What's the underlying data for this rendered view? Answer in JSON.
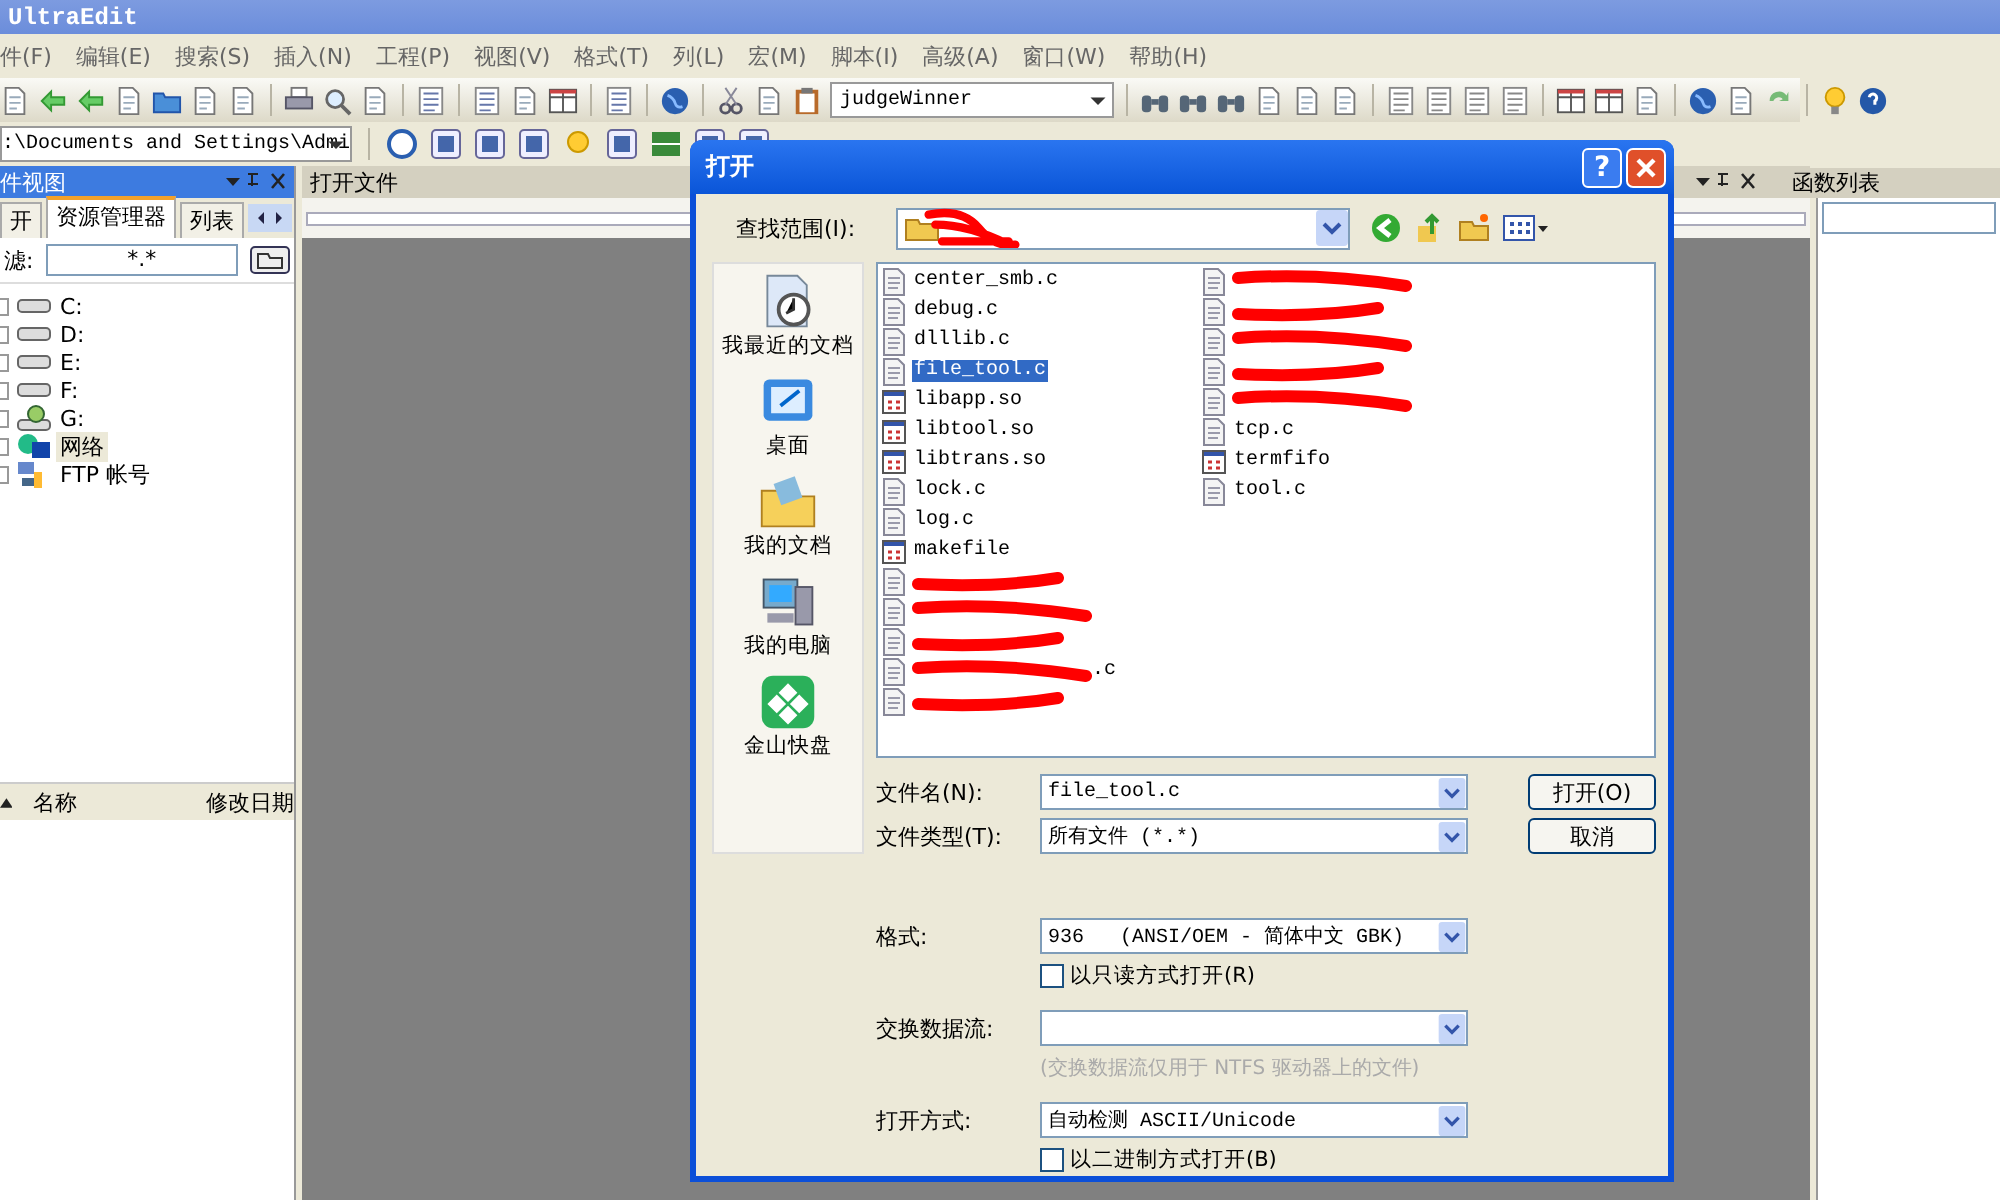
{
  "window": {
    "title": "UltraEdit"
  },
  "menu": [
    "件(F)",
    "编辑(E)",
    "搜索(S)",
    "插入(N)",
    "工程(P)",
    "视图(V)",
    "格式(T)",
    "列(L)",
    "宏(M)",
    "脚本(I)",
    "高级(A)",
    "窗口(W)",
    "帮助(H)"
  ],
  "function_combo": {
    "value": "judgeWinner"
  },
  "path_combo": {
    "value": ":\\Documents and Settings\\Admi"
  },
  "file_view": {
    "title": "件视图",
    "tabs": [
      {
        "label": "开",
        "selected": false
      },
      {
        "label": "资源管理器",
        "selected": true
      },
      {
        "label": "列表",
        "selected": false
      }
    ],
    "filter": {
      "label": "滤:",
      "value": "*.*"
    },
    "tree": [
      {
        "label": "C:",
        "kind": "drive",
        "selected": false
      },
      {
        "label": "D:",
        "kind": "drive",
        "selected": false
      },
      {
        "label": "E:",
        "kind": "drive",
        "selected": false
      },
      {
        "label": "F:",
        "kind": "drive",
        "selected": false
      },
      {
        "label": "G:",
        "kind": "share",
        "selected": false
      },
      {
        "label": "网络",
        "kind": "network",
        "selected": true
      },
      {
        "label": "FTP 帐号",
        "kind": "ftp",
        "selected": false
      }
    ],
    "columns": [
      "名称",
      "修改日期"
    ]
  },
  "open_files": {
    "title": "打开文件"
  },
  "function_list": {
    "title": "函数列表"
  },
  "dialog": {
    "title": "打开",
    "help": "?",
    "look_in": {
      "label": "查找范围(I):"
    },
    "places": [
      "我最近的文档",
      "桌面",
      "我的文档",
      "我的电脑",
      "金山快盘"
    ],
    "file_columns": [
      [
        {
          "name": "center_smb.c",
          "kind": "text",
          "selected": false
        },
        {
          "name": "debug.c",
          "kind": "text",
          "selected": false
        },
        {
          "name": "dlllib.c",
          "kind": "text",
          "selected": false
        },
        {
          "name": "file_tool.c",
          "kind": "text",
          "selected": true
        },
        {
          "name": "libapp.so",
          "kind": "binary",
          "selected": false
        },
        {
          "name": "libtool.so",
          "kind": "binary",
          "selected": false
        },
        {
          "name": "libtrans.so",
          "kind": "binary",
          "selected": false
        },
        {
          "name": "lock.c",
          "kind": "text",
          "selected": false
        },
        {
          "name": "log.c",
          "kind": "text",
          "selected": false
        },
        {
          "name": "makefile",
          "kind": "binary",
          "selected": false
        },
        {
          "kind": "redacted",
          "selected": false
        },
        {
          "kind": "redacted",
          "selected": false
        },
        {
          "kind": "redacted",
          "selected": false
        },
        {
          "name": ".c",
          "kind": "redacted",
          "selected": false
        },
        {
          "kind": "redacted",
          "selected": false
        }
      ],
      [
        {
          "kind": "redacted",
          "selected": false
        },
        {
          "kind": "redacted",
          "selected": false
        },
        {
          "kind": "redacted",
          "selected": false
        },
        {
          "kind": "redacted",
          "selected": false
        },
        {
          "kind": "redacted",
          "selected": false
        },
        {
          "name": "tcp.c",
          "kind": "text",
          "selected": false
        },
        {
          "name": "termfifo",
          "kind": "binary",
          "selected": false
        },
        {
          "name": "tool.c",
          "kind": "text",
          "selected": false
        }
      ]
    ],
    "file_name": {
      "label": "文件名(N):",
      "value": "file_tool.c"
    },
    "file_type": {
      "label": "文件类型(T):",
      "value": "所有文件 (*.*)"
    },
    "buttons": [
      "打开(O)",
      "取消"
    ],
    "format": {
      "label": "格式:",
      "value": "936   (ANSI/OEM - 简体中文 GBK)"
    },
    "readonly": {
      "label": "以只读方式打开(R)",
      "checked": false
    },
    "stream": {
      "label": "交换数据流:",
      "note": "(交换数据流仅用于 NTFS 驱动器上的文件)"
    },
    "open_as": {
      "label": "打开方式:",
      "value": "自动检测 ASCII/Unicode"
    },
    "binary": {
      "label": "以二进制方式打开(B)",
      "checked": false
    }
  }
}
